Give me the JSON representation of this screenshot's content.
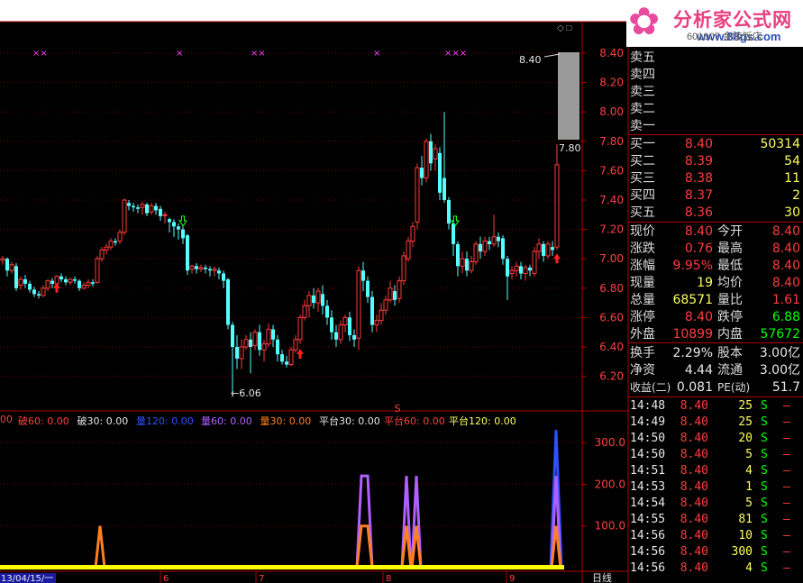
{
  "brand": {
    "name": "分析家公式网",
    "url": "www.88gs.com"
  },
  "window": {
    "faint_title": "601007  金陵饭店",
    "buttons": "◇ □"
  },
  "price_axis": {
    "ticks": [
      "8.40",
      "8.20",
      "8.00",
      "7.80",
      "7.60",
      "7.40",
      "7.20",
      "7.00",
      "6.80",
      "6.60",
      "6.40",
      "6.20"
    ]
  },
  "annotations": {
    "high_label": "8.40",
    "low_label": "←6.06",
    "price_tag": "7.80",
    "marker_s": "S"
  },
  "indicator_axis": {
    "ticks": [
      "300.0",
      "200.0",
      "100.0"
    ]
  },
  "indicator_legend": [
    {
      "label": "00",
      "color": "#ff4040"
    },
    {
      "label": "破60: 0.00",
      "color": "#ff4040"
    },
    {
      "label": "破30: 0.00",
      "color": "#e8e8e8"
    },
    {
      "label": "量120: 0.00",
      "color": "#3050ff"
    },
    {
      "label": "量60: 0.00",
      "color": "#b060ff"
    },
    {
      "label": "量30: 0.00",
      "color": "#ff8020"
    },
    {
      "label": "平台30: 0.00",
      "color": "#e8e8e8"
    },
    {
      "label": "平台60: 0.00",
      "color": "#ff4040"
    },
    {
      "label": "平台120: 0.00",
      "color": "#ffff60"
    }
  ],
  "date_axis": {
    "start": "13/04/15/一",
    "marks": [
      "6",
      "7",
      "8",
      "9"
    ],
    "period": "日线"
  },
  "order_book": {
    "sell": [
      {
        "label": "卖五",
        "price": "",
        "volume": ""
      },
      {
        "label": "卖四",
        "price": "",
        "volume": ""
      },
      {
        "label": "卖三",
        "price": "",
        "volume": ""
      },
      {
        "label": "卖二",
        "price": "",
        "volume": ""
      },
      {
        "label": "卖一",
        "price": "",
        "volume": ""
      }
    ],
    "buy": [
      {
        "label": "买一",
        "price": "8.40",
        "volume": "50314"
      },
      {
        "label": "买二",
        "price": "8.39",
        "volume": "54"
      },
      {
        "label": "买三",
        "price": "8.38",
        "volume": "11"
      },
      {
        "label": "买四",
        "price": "8.37",
        "volume": "2"
      },
      {
        "label": "买五",
        "price": "8.36",
        "volume": "30"
      }
    ]
  },
  "stats": [
    {
      "l1": "现价",
      "v1": "8.40",
      "c1": "red",
      "l2": "今开",
      "v2": "8.40",
      "c2": "red"
    },
    {
      "l1": "涨跌",
      "v1": "0.76",
      "c1": "red",
      "l2": "最高",
      "v2": "8.40",
      "c2": "red"
    },
    {
      "l1": "涨幅",
      "v1": "9.95%",
      "c1": "red",
      "l2": "最低",
      "v2": "8.40",
      "c2": "red"
    },
    {
      "l1": "现量",
      "v1": "19",
      "c1": "yellow",
      "l2": "均价",
      "v2": "8.40",
      "c2": "red"
    },
    {
      "l1": "总量",
      "v1": "68571",
      "c1": "yellow",
      "l2": "量比",
      "v2": "1.61",
      "c2": "red"
    },
    {
      "l1": "涨停",
      "v1": "8.40",
      "c1": "red",
      "l2": "跌停",
      "v2": "6.88",
      "c2": "green"
    },
    {
      "l1": "外盘",
      "v1": "10899",
      "c1": "red",
      "l2": "内盘",
      "v2": "57672",
      "c2": "green"
    }
  ],
  "fundamentals": [
    {
      "l1": "换手",
      "v1": "2.29%",
      "l2": "股本",
      "v2": "3.00亿"
    },
    {
      "l1": "净资",
      "v1": "4.44",
      "l2": "流通",
      "v2": "3.00亿"
    },
    {
      "l1": "收益(二)",
      "v1": "0.081",
      "l2": "PE(动)",
      "v2": "51.7"
    }
  ],
  "trades": [
    {
      "time": "14:48",
      "price": "8.40",
      "volume": "25",
      "side": "S"
    },
    {
      "time": "14:49",
      "price": "8.40",
      "volume": "25",
      "side": "S"
    },
    {
      "time": "14:50",
      "price": "8.40",
      "volume": "20",
      "side": "S"
    },
    {
      "time": "14:50",
      "price": "8.40",
      "volume": "5",
      "side": "S"
    },
    {
      "time": "14:51",
      "price": "8.40",
      "volume": "4",
      "side": "S"
    },
    {
      "time": "14:53",
      "price": "8.40",
      "volume": "1",
      "side": "S"
    },
    {
      "time": "14:54",
      "price": "8.40",
      "volume": "5",
      "side": "S"
    },
    {
      "time": "14:55",
      "price": "8.40",
      "volume": "81",
      "side": "S"
    },
    {
      "time": "14:56",
      "price": "8.40",
      "volume": "10",
      "side": "S"
    },
    {
      "time": "14:56",
      "price": "8.40",
      "volume": "300",
      "side": "S"
    },
    {
      "time": "14:56",
      "price": "8.40",
      "volume": "4",
      "side": "S"
    }
  ],
  "chart_data": {
    "type": "candlestick",
    "ylim": [
      6.06,
      8.4
    ],
    "high": 8.4,
    "low": 6.06,
    "last_close": 8.4,
    "prev_tag": 7.8,
    "indicator_ylim": [
      0,
      300
    ]
  },
  "colors": {
    "up": "#ff3c3c",
    "down": "#54ffff",
    "grid": "#7a0000",
    "axis": "#b00000"
  }
}
